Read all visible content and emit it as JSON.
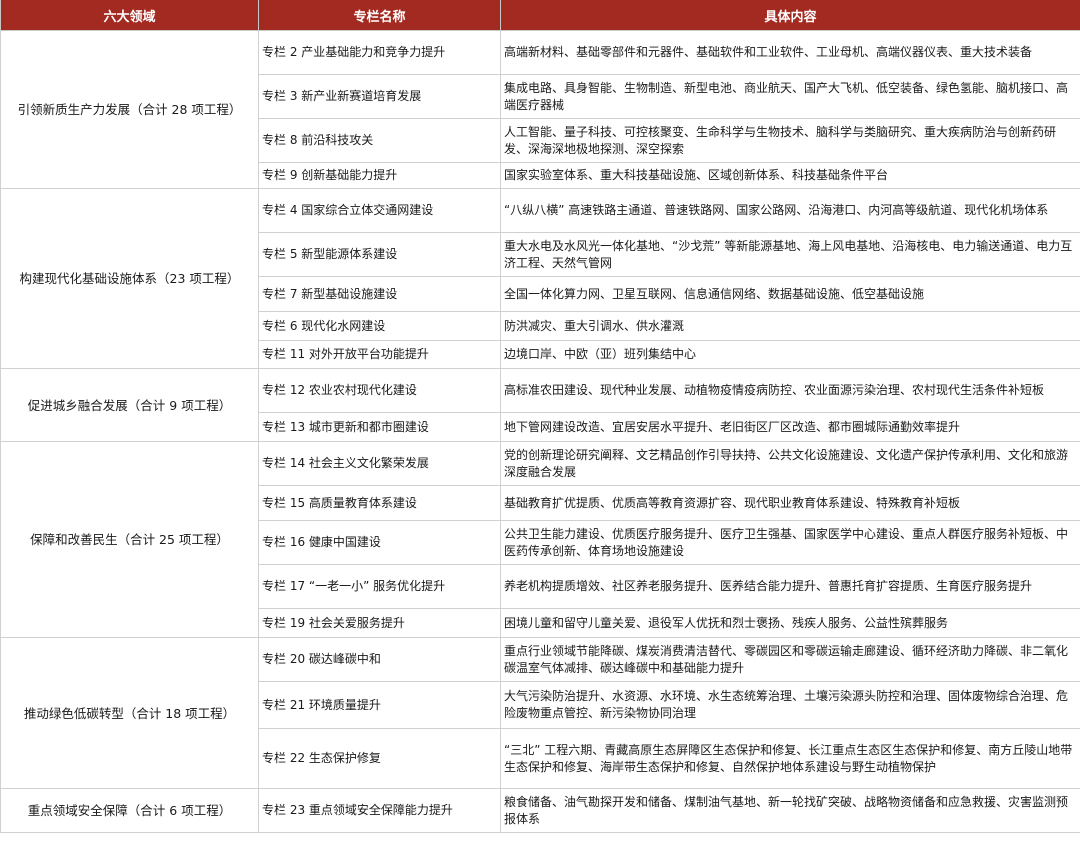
{
  "headers": [
    "六大领域",
    "专栏名称",
    "具体内容"
  ],
  "groups": [
    {
      "domain": "引领新质生产力发展（合计 28 项工程）",
      "rows": [
        {
          "col": "专栏 2 产业基础能力和竞争力提升",
          "content": "高端新材料、基础零部件和元器件、基础软件和工业软件、工业母机、高端仪器仪表、重大技术装备"
        },
        {
          "col": "专栏 3 新产业新赛道培育发展",
          "content": "集成电路、具身智能、生物制造、新型电池、商业航天、国产大飞机、低空装备、绿色氢能、脑机接口、高端医疗器械"
        },
        {
          "col": "专栏 8 前沿科技攻关",
          "content": "人工智能、量子科技、可控核聚变、生命科学与生物技术、脑科学与类脑研究、重大疾病防治与创新药研发、深海深地极地探测、深空探索"
        },
        {
          "col": "专栏 9 创新基础能力提升",
          "content": "国家实验室体系、重大科技基础设施、区域创新体系、科技基础条件平台"
        }
      ]
    },
    {
      "domain": "构建现代化基础设施体系（23 项工程）",
      "rows": [
        {
          "col": "专栏 4 国家综合立体交通网建设",
          "content": "“八纵八横” 高速铁路主通道、普速铁路网、国家公路网、沿海港口、内河高等级航道、现代化机场体系"
        },
        {
          "col": "专栏 5 新型能源体系建设",
          "content": "重大水电及水风光一体化基地、“沙戈荒” 等新能源基地、海上风电基地、沿海核电、电力输送通道、电力互济工程、天然气管网"
        },
        {
          "col": "专栏 7 新型基础设施建设",
          "content": "全国一体化算力网、卫星互联网、信息通信网络、数据基础设施、低空基础设施"
        },
        {
          "col": "专栏 6 现代化水网建设",
          "content": "防洪减灾、重大引调水、供水灌溉"
        },
        {
          "col": "专栏 11 对外开放平台功能提升",
          "content": "边境口岸、中欧（亚）班列集结中心"
        }
      ]
    },
    {
      "domain": "促进城乡融合发展（合计 9 项工程）",
      "rows": [
        {
          "col": "专栏 12 农业农村现代化建设",
          "content": "高标准农田建设、现代种业发展、动植物疫情疫病防控、农业面源污染治理、农村现代生活条件补短板"
        },
        {
          "col": "专栏 13 城市更新和都市圈建设",
          "content": "地下管网建设改造、宜居安居水平提升、老旧街区厂区改造、都市圈城际通勤效率提升"
        }
      ]
    },
    {
      "domain": "保障和改善民生（合计 25 项工程）",
      "rows": [
        {
          "col": "专栏 14 社会主义文化繁荣发展",
          "content": "党的创新理论研究阐释、文艺精品创作引导扶持、公共文化设施建设、文化遗产保护传承利用、文化和旅游深度融合发展"
        },
        {
          "col": "专栏 15 高质量教育体系建设",
          "content": "基础教育扩优提质、优质高等教育资源扩容、现代职业教育体系建设、特殊教育补短板"
        },
        {
          "col": "专栏 16 健康中国建设",
          "content": "公共卫生能力建设、优质医疗服务提升、医疗卫生强基、国家医学中心建设、重点人群医疗服务补短板、中医药传承创新、体育场地设施建设"
        },
        {
          "col": "专栏 17 “一老一小” 服务优化提升",
          "content": "养老机构提质增效、社区养老服务提升、医养结合能力提升、普惠托育扩容提质、生育医疗服务提升"
        },
        {
          "col": "专栏 19 社会关爱服务提升",
          "content": "困境儿童和留守儿童关爱、退役军人优抚和烈士褒扬、残疾人服务、公益性殡葬服务"
        }
      ]
    },
    {
      "domain": "推动绿色低碳转型（合计 18 项工程）",
      "rows": [
        {
          "col": "专栏 20 碳达峰碳中和",
          "content": "重点行业领域节能降碳、煤炭消费清洁替代、零碳园区和零碳运输走廊建设、循环经济助力降碳、非二氧化碳温室气体减排、碳达峰碳中和基础能力提升"
        },
        {
          "col": "专栏 21 环境质量提升",
          "content": "大气污染防治提升、水资源、水环境、水生态统筹治理、土壤污染源头防控和治理、固体废物综合治理、危险废物重点管控、新污染物协同治理"
        },
        {
          "col": "专栏 22 生态保护修复",
          "content": "“三北” 工程六期、青藏高原生态屏障区生态保护和修复、长江重点生态区生态保护和修复、南方丘陵山地带生态保护和修复、海岸带生态保护和修复、自然保护地体系建设与野生动植物保护"
        }
      ]
    },
    {
      "domain": "重点领域安全保障（合计 6 项工程）",
      "rows": [
        {
          "col": "专栏 23 重点领域安全保障能力提升",
          "content": "粮食储备、油气勘探开发和储备、煤制油气基地、新一轮找矿突破、战略物资储备和应急救援、灾害监测预报体系"
        }
      ]
    }
  ]
}
